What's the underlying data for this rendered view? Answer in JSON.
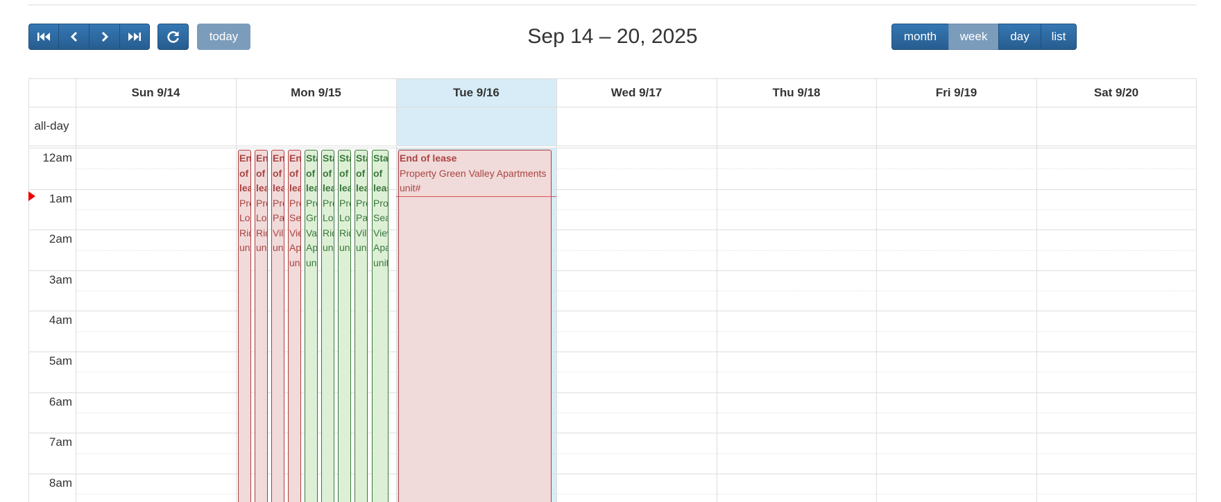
{
  "toolbar": {
    "nav_icons": [
      "first-icon",
      "prev-icon",
      "next-icon",
      "last-icon"
    ],
    "refresh_icon": "refresh-icon",
    "today_label": "today",
    "title": "Sep 14 – 20, 2025",
    "views": [
      {
        "label": "month",
        "active": false
      },
      {
        "label": "week",
        "active": true
      },
      {
        "label": "day",
        "active": false
      },
      {
        "label": "list",
        "active": false
      }
    ]
  },
  "calendar": {
    "allday_label": "all-day",
    "days": [
      {
        "label": "Sun 9/14",
        "today": false
      },
      {
        "label": "Mon 9/15",
        "today": false
      },
      {
        "label": "Tue 9/16",
        "today": true
      },
      {
        "label": "Wed 9/17",
        "today": false
      },
      {
        "label": "Thu 9/18",
        "today": false
      },
      {
        "label": "Fri 9/19",
        "today": false
      },
      {
        "label": "Sat 9/20",
        "today": false
      }
    ],
    "times": [
      "12am",
      "1am",
      "2am",
      "3am",
      "4am",
      "5am",
      "6am",
      "7am",
      "8am"
    ],
    "colors": {
      "end_bg": "#f1dada",
      "end_border": "#b23b3b",
      "start_bg": "#ddf0d6",
      "start_border": "#3c763d",
      "today_bg": "#d7ecf6",
      "now_indicator": "#e00000"
    },
    "mon_events": [
      {
        "type": "end",
        "title": "End of lease",
        "desc": "Property Lonely Ridge unit#"
      },
      {
        "type": "end",
        "title": "End of lease",
        "desc": "Property Lonely Ridge unit#"
      },
      {
        "type": "end",
        "title": "End of lease",
        "desc": "Property Palm Villa unit#"
      },
      {
        "type": "end",
        "title": "End of lease",
        "desc": "Property Sea View Apartments unit#"
      },
      {
        "type": "start",
        "title": "Start of lease",
        "desc": "Property Green Valley Apartments unit#"
      },
      {
        "type": "start",
        "title": "Start of lease",
        "desc": "Property Lonely Ridge unit#"
      },
      {
        "type": "start",
        "title": "Start of lease",
        "desc": "Property Lonely Ridge unit#"
      },
      {
        "type": "start",
        "title": "Start of lease",
        "desc": "Property Palm Villa unit#"
      },
      {
        "type": "start",
        "title": "Start of lease",
        "desc": "Property Sea View Apartments unit#"
      }
    ],
    "tue_event": {
      "type": "end",
      "title": "End of lease",
      "desc": "Property Green Valley Apartments unit#"
    }
  }
}
